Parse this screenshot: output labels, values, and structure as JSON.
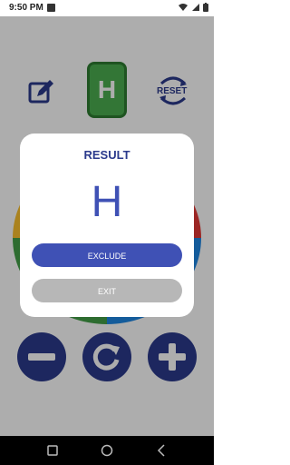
{
  "status_bar": {
    "time": "9:50 PM",
    "battery_icon": "battery-icon",
    "wifi_icon": "wifi-icon",
    "signal_icon": "signal-icon"
  },
  "toolbar": {
    "edit_icon": "edit-icon",
    "current_letter": "H",
    "reset_label": "RESET"
  },
  "controls": {
    "minus_icon": "minus-icon",
    "spin_icon": "rotate-icon",
    "plus_icon": "plus-icon"
  },
  "dialog": {
    "title": "RESULT",
    "letter": "H",
    "exclude_label": "EXCLUDE",
    "exit_label": "EXIT"
  },
  "colors": {
    "primary": "#2b3a8c",
    "accent": "#3f51b5",
    "tile_green": "#4caf50",
    "exit_gray": "#b7b7b7"
  }
}
